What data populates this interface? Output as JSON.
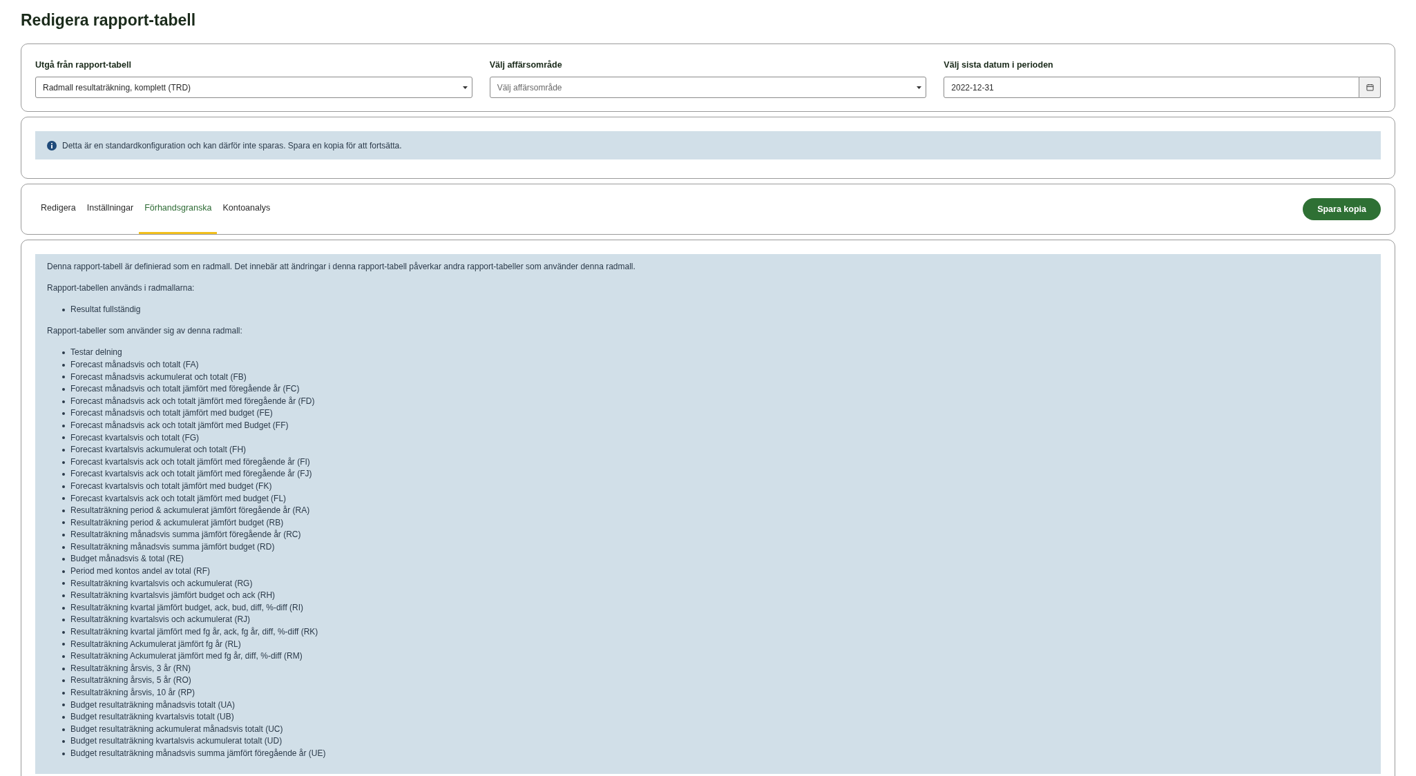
{
  "page_title": "Redigera rapport-tabell",
  "filters": [
    {
      "kind": "select",
      "label": "Utgå från rapport-tabell",
      "value": "Radmall resultaträkning, komplett (TRD)"
    },
    {
      "kind": "select",
      "label": "Välj affärsområde",
      "placeholder": "Välj affärsområde"
    },
    {
      "kind": "date",
      "label": "Välj sista datum i perioden",
      "value": "2022-12-31"
    }
  ],
  "notice": "Detta är en standardkonfiguration och kan därför inte sparas. Spara en kopia för att fortsätta.",
  "tabs": [
    {
      "label": "Redigera",
      "selected": false
    },
    {
      "label": "Inställningar",
      "selected": false
    },
    {
      "label": "Förhandsgranska",
      "selected": true
    },
    {
      "label": "Kontoanalys",
      "selected": false
    }
  ],
  "save_copy_button": "Spara kopia",
  "preview": {
    "intro": "Denna rapport-tabell är definierad som en radmall. Det innebär att ändringar i denna rapport-tabell påverkar andra rapport-tabeller som använder denna radmall.",
    "used_in_heading": "Rapport-tabellen används i radmallarna:",
    "used_in": [
      "Resultat fullständig"
    ],
    "users_heading": "Rapport-tabeller som använder sig av denna radmall:",
    "users": [
      "Testar delning",
      "Forecast månadsvis och totalt (FA)",
      "Forecast månadsvis ackumulerat och totalt (FB)",
      "Forecast månadsvis och totalt jämfört med föregående år (FC)",
      "Forecast månadsvis ack och totalt jämfört med föregående år (FD)",
      "Forecast månadsvis och totalt jämfört med budget (FE)",
      "Forecast månadsvis ack och totalt jämfört med Budget (FF)",
      "Forecast kvartalsvis och totalt (FG)",
      "Forecast kvartalsvis ackumulerat och totalt (FH)",
      "Forecast kvartalsvis ack och totalt jämfört med föregående år (FI)",
      "Forecast kvartalsvis ack och totalt jämfört med föregående år (FJ)",
      "Forecast kvartalsvis och totalt jämfört med budget (FK)",
      "Forecast kvartalsvis ack och totalt jämfört med budget (FL)",
      "Resultaträkning period & ackumulerat jämfört föregående år (RA)",
      "Resultaträkning period & ackumulerat jämfört budget (RB)",
      "Resultaträkning månadsvis summa jämfört föregående år (RC)",
      "Resultaträkning månadsvis summa jämfört budget (RD)",
      "Budget månadsvis & total (RE)",
      "Period med kontos andel av total (RF)",
      "Resultaträkning kvartalsvis och ackumulerat (RG)",
      "Resultaträkning kvartalsvis jämfört budget och ack (RH)",
      "Resultaträkning kvartal jämfört budget, ack, bud, diff, %-diff (RI)",
      "Resultaträkning kvartalsvis och ackumulerat (RJ)",
      "Resultaträkning kvartal jämfört med fg år, ack, fg år, diff, %-diff (RK)",
      "Resultaträkning Ackumulerat jämfört fg år (RL)",
      "Resultaträkning Ackumulerat jämfört med fg år, diff, %-diff (RM)",
      "Resultaträkning årsvis, 3 år (RN)",
      "Resultaträkning årsvis, 5 år (RO)",
      "Resultaträkning årsvis, 10 år (RP)",
      "Budget resultaträkning månadsvis totalt (UA)",
      "Budget resultaträkning kvartalsvis totalt (UB)",
      "Budget resultaträkning ackumulerat månadsvis totalt (UC)",
      "Budget resultaträkning kvartalsvis ackumulerat totalt (UD)",
      "Budget resultaträkning månadsvis summa jämfört föregående år (UE)"
    ]
  }
}
